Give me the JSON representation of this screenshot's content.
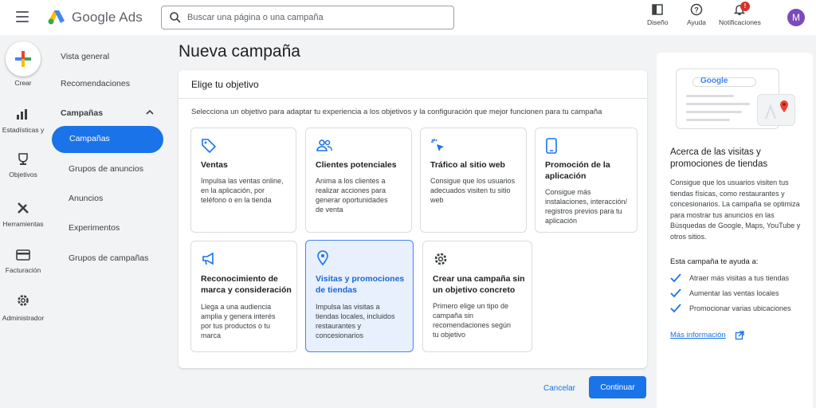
{
  "app": {
    "brand": "Google Ads"
  },
  "search": {
    "placeholder": "Buscar una página o una campaña"
  },
  "topbar": {
    "design_label": "Diseño",
    "help_label": "Ayuda",
    "notifications_label": "Notificaciones",
    "notifications_count": "!",
    "avatar_letter": "M"
  },
  "rail": {
    "create": "Crear",
    "stats": "Estadísticas y",
    "goals": "Objetivos",
    "tools": "Herramientas",
    "billing": "Facturación",
    "admin": "Administrador"
  },
  "nav": {
    "overview": "Vista general",
    "recommendations": "Recomendaciones",
    "section": "Campañas",
    "campaigns": "Campañas",
    "ad_groups": "Grupos de anuncios",
    "ads": "Anuncios",
    "experiments": "Experimentos",
    "campaign_groups": "Grupos de campañas"
  },
  "main": {
    "title": "Nueva campaña",
    "card_title": "Elige tu objetivo",
    "description": "Selecciona un objetivo para adaptar tu experiencia a los objetivos y la configuración que mejor funcionen para tu campaña",
    "objectives": [
      {
        "title": "Ventas",
        "desc": [
          "Impulsa las ventas online,",
          "en la aplicación, por",
          "teléfono o en la tienda"
        ],
        "icon": "tag-icon"
      },
      {
        "title": "Clientes potenciales",
        "desc": [
          "Anima a los clientes a",
          "realizar acciones para",
          "generar oportunidades",
          "de venta"
        ],
        "icon": "people-icon"
      },
      {
        "title": "Tráfico al sitio web",
        "desc": [
          "Consigue que los usuarios",
          "adecuados visiten tu sitio",
          "web"
        ],
        "icon": "cursor-click-icon"
      },
      {
        "title_lines": [
          "Promoción de la",
          "aplicación"
        ],
        "desc": [
          "Consigue más",
          "instalaciones, interacción/",
          "registros previos para tu",
          "aplicación"
        ],
        "icon": "phone-icon"
      },
      {
        "title_lines": [
          "Reconocimiento de",
          "marca y consideración"
        ],
        "desc": [
          "Llega a una audiencia",
          "amplia y genera interés",
          "por tus productos o tu",
          "marca"
        ],
        "icon": "megaphone-icon"
      },
      {
        "title_lines": [
          "Visitas y promociones",
          "de tiendas"
        ],
        "desc": [
          "Impulsa las visitas a",
          "tiendas locales, incluidos",
          "restaurantes y",
          "concesionarios"
        ],
        "icon": "location-pin-icon",
        "selected": true
      },
      {
        "title_lines": [
          "Crear una campaña sin",
          "un objetivo concreto"
        ],
        "desc": [
          "Primero elige un tipo de",
          "campaña sin",
          "recomendaciones según",
          "tu objetivo"
        ],
        "icon": "settings-gear-icon"
      }
    ],
    "cancel": "Cancelar",
    "continue": "Continuar"
  },
  "side": {
    "illustration_word": "Google",
    "heading": "Acerca de las visitas y promociones de tiendas",
    "body": "Consigue que los usuarios visiten tus tiendas físicas, como restaurantes y concesionarios. La campaña se optimiza para mostrar tus anuncios en las Búsquedas de Google, Maps, YouTube y otros sitios.",
    "subheading": "Esta campaña te ayuda a:",
    "bullets": [
      "Atraer más visitas a tus tiendas",
      "Aumentar las ventas locales",
      "Promocionar varias ubicaciones"
    ],
    "more": "Más información"
  },
  "colors": {
    "accent": "#1a73e8",
    "selected_bg": "#e8f0fe",
    "avatar": "#7b4bb9",
    "badge": "#d93025"
  }
}
